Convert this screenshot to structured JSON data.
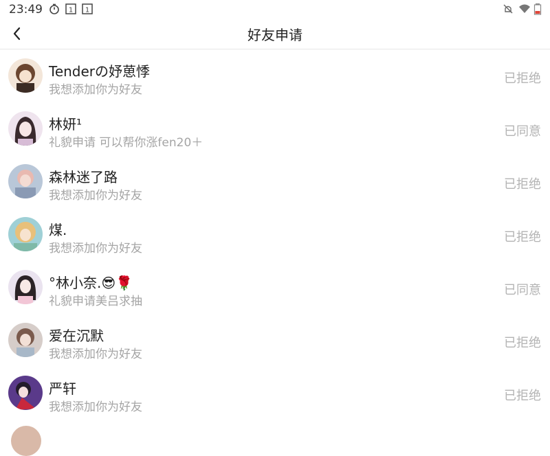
{
  "status_bar": {
    "time": "23:49",
    "left_icons": [
      "timer-icon",
      "notification-badge-icon",
      "notification-badge-icon"
    ],
    "right_icons": [
      "mute-icon",
      "wifi-icon",
      "battery-low-icon"
    ],
    "badge_number": "1"
  },
  "header": {
    "title": "好友申请",
    "back_icon": "chevron-left-icon"
  },
  "requests": [
    {
      "name": "Tenderの妤葸悸",
      "message": "我想添加你为好友",
      "status": "已拒绝",
      "avatar_color": "#c9a27e"
    },
    {
      "name": "林妍¹",
      "message": "礼貌申请 可以帮你涨fen20＋",
      "status": "已同意",
      "avatar_color": "#d8c5d6"
    },
    {
      "name": "森林迷了路",
      "message": "我想添加你为好友",
      "status": "已拒绝",
      "avatar_color": "#a7b9cf"
    },
    {
      "name": "煤.",
      "message": "我想添加你为好友",
      "status": "已拒绝",
      "avatar_color": "#e8c58e"
    },
    {
      "name": "°林小奈.😎🌹",
      "message": "礼貌申请美吕求抽",
      "status": "已同意",
      "avatar_color": "#e6d6e6"
    },
    {
      "name": "爱在沉默",
      "message": "我想添加你为好友",
      "status": "已拒绝",
      "avatar_color": "#c9b8b0"
    },
    {
      "name": "严轩",
      "message": "我想添加你为好友",
      "status": "已拒绝",
      "avatar_color": "#b03a4e"
    }
  ]
}
